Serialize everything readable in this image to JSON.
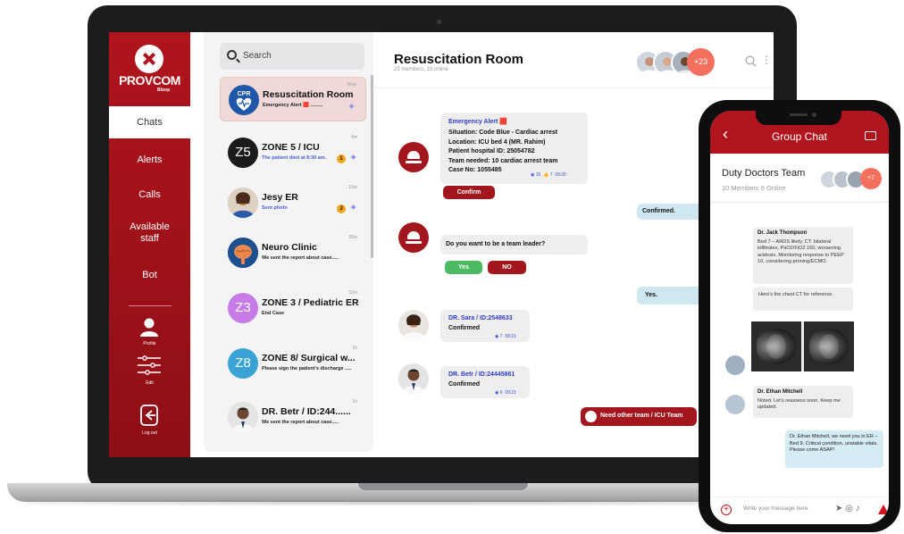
{
  "sidebar": {
    "logo": "PROVCOM",
    "logo_sub": "Bloop",
    "nav": [
      "Chats",
      "Alerts",
      "Calls",
      "Available staff",
      "Bot"
    ],
    "profile_label": "Profile",
    "edit_label": "Edit",
    "logout_label": "Log out"
  },
  "chatlist": {
    "search_placeholder": "Search",
    "items": [
      {
        "avatar": "CPR",
        "title": "Resuscitation Room",
        "subtitle": "Emergency Alert 🟥 .........",
        "time": "Now"
      },
      {
        "avatar": "Z5",
        "title": "ZONE 5 / ICU",
        "subtitle": "The patient died at 8:30 am.",
        "time": "4m",
        "badge": "1"
      },
      {
        "avatar": "",
        "title": "Jesy ER",
        "subtitle": "Sent photo",
        "time": "15m",
        "badge": "3"
      },
      {
        "avatar": "",
        "title": "Neuro Clinic",
        "subtitle": "We sent the report about case.....",
        "time": "28m"
      },
      {
        "avatar": "Z3",
        "title": "ZONE 3 / Pediatric ER",
        "subtitle": "End Case",
        "time": "33m"
      },
      {
        "avatar": "Z8",
        "title": "ZONE 8/ Surgical w...",
        "subtitle": "Please sign the patient's discharge .....",
        "time": "1h"
      },
      {
        "avatar": "",
        "title": "DR. Betr / ID:244......",
        "subtitle": "We sent the report about case.....",
        "time": "1h"
      }
    ]
  },
  "chat": {
    "title": "Resuscitation Room",
    "subtitle": "23 members, 15 online",
    "members_more": "+23",
    "alert": {
      "title": "Emergency Alert 🟥",
      "lines": [
        "Situation: Code Blue - Cardiac arrest",
        "Location: ICU bed 4 (MR. Rahim)",
        "Patient hospital ID: 25054782",
        "Team needed: 10 cardiac arrest team",
        "Case No: 1055485"
      ],
      "seen": "15",
      "likes": "7",
      "time": "09:20",
      "confirm_label": "Confirm"
    },
    "reply_confirmed": "Confirmed.",
    "question": "Do you want to be a team leader?",
    "yes_label": "Yes",
    "no_label": "NO",
    "reply_yes": "Yes.",
    "msg_sara": {
      "name": "DR. Sara / ID:2548633",
      "text": "Confirmed",
      "seen": "7",
      "time": "09:21"
    },
    "msg_betr": {
      "name": "DR. Betr / ID:24445861",
      "text": "Confirmed",
      "seen": "6",
      "time": "09:21"
    },
    "need_team": "Need other team / ICU Team"
  },
  "phone": {
    "header_title": "Group Chat",
    "team_name": "Duty Doctors Team",
    "team_sub": "10 Members  6 Online",
    "members_more": "+7",
    "msg1": {
      "name": "Dr. Jack Thompson",
      "text": "Bed 7 – ARDS likely. CT: bilateral infiltrates, PaO2/FiO2 160, worsening acidosis. Monitoring response to PEEP 10, considering proning/ECMO."
    },
    "msg2": {
      "text": "Here's the chest CT for reference."
    },
    "msg3": {
      "name": "Dr. Ethan Mitchell",
      "text": "Noted. Let's reassess soon. Keep me updated."
    },
    "msg4": {
      "text": "Dr. Ethan Mitchell, we need you in ER – Bed 9. Critical condition, unstable vitals. Please come ASAP!"
    },
    "input_placeholder": "Write your message here"
  },
  "colors": {
    "brand_red": "#b0141d",
    "accent_blue": "#2f3ec2",
    "out_bubble": "#cfe8f0"
  }
}
